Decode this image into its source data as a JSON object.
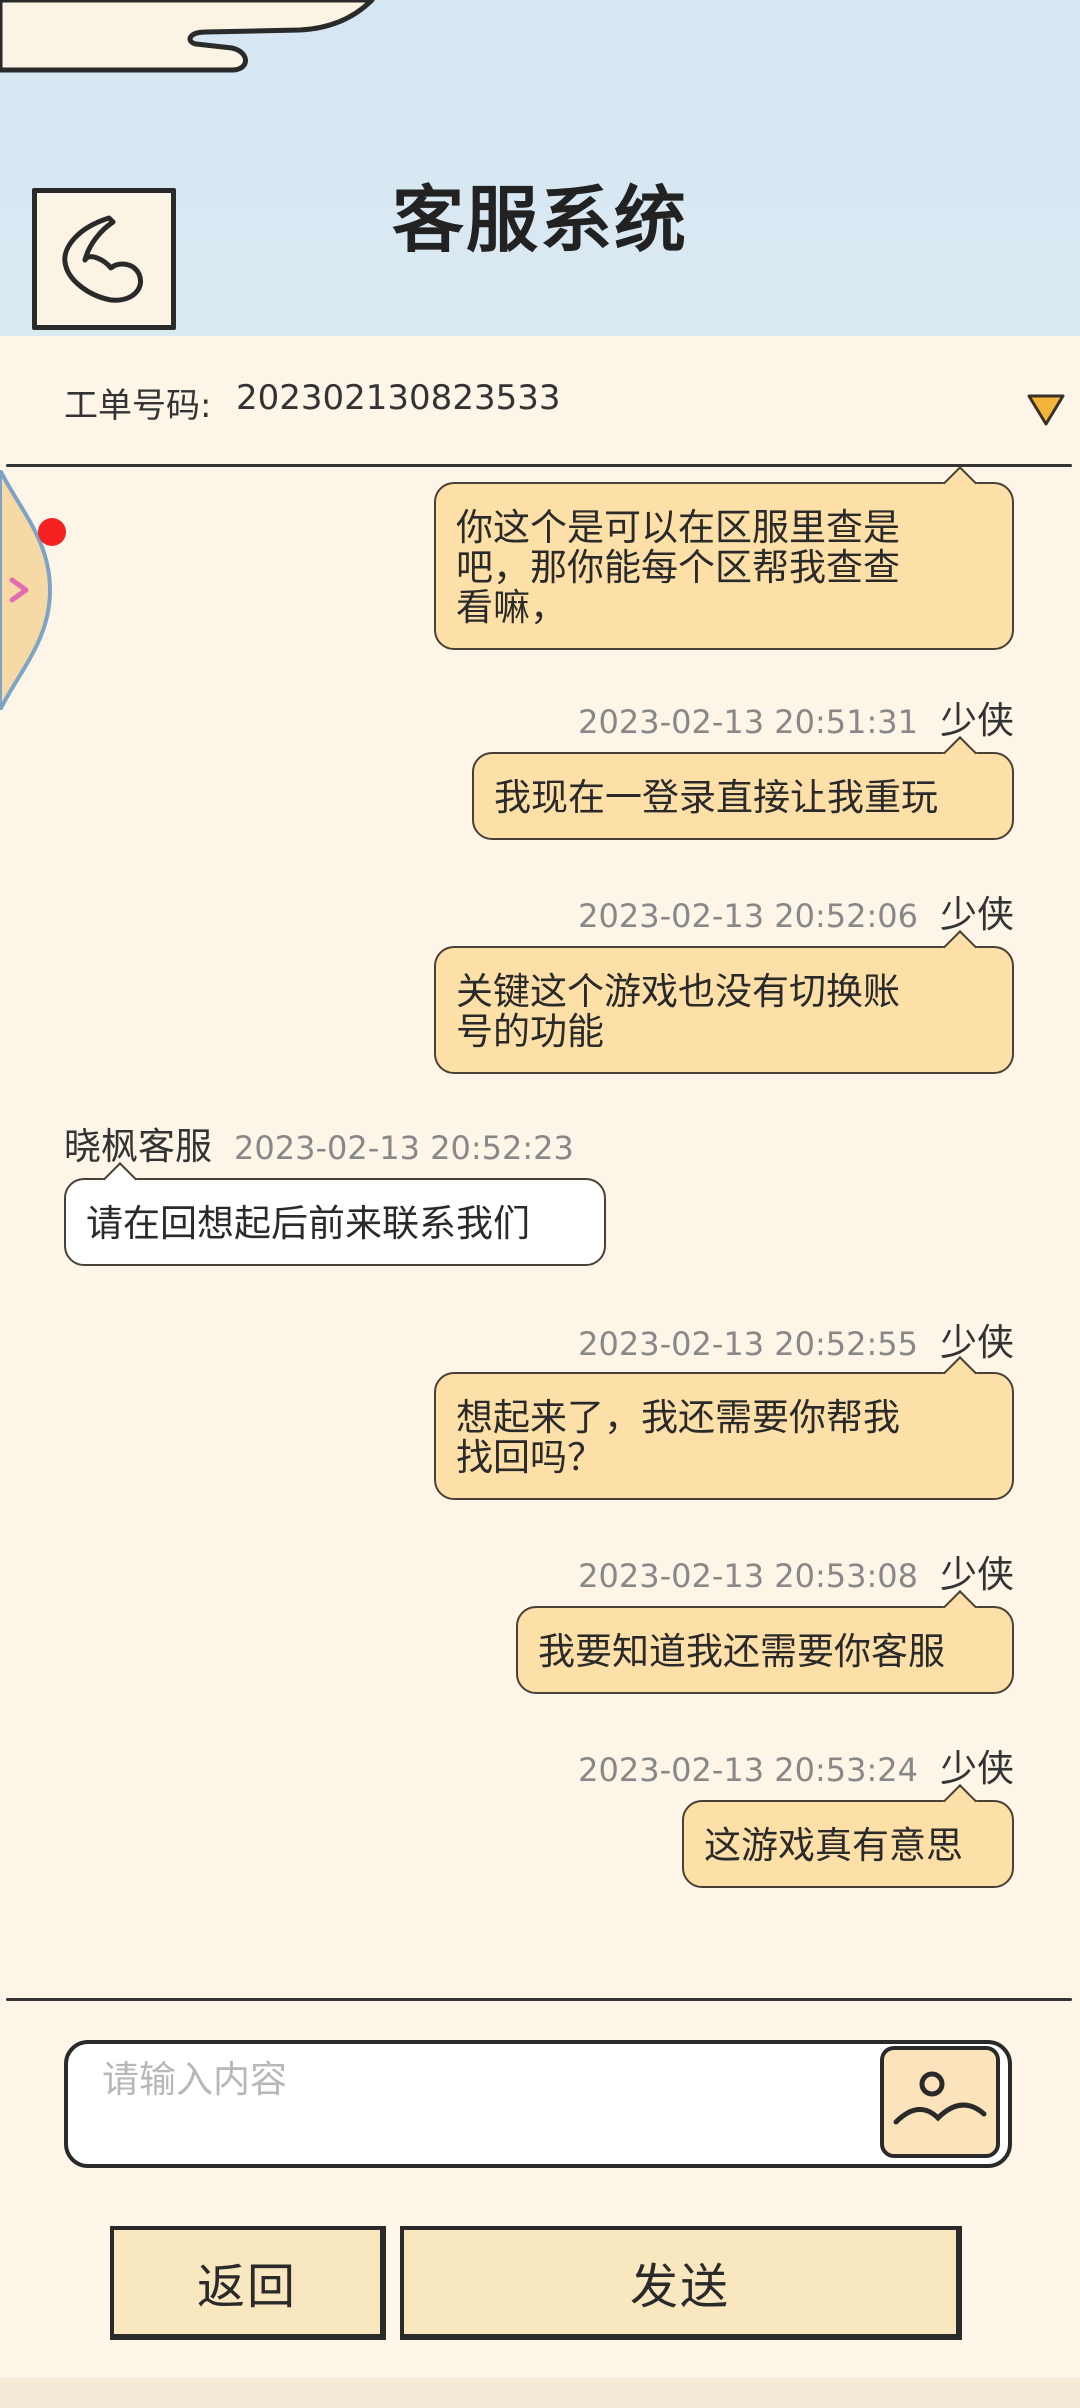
{
  "header": {
    "title": "客服系统",
    "back_icon": "back-heart-icon"
  },
  "ticket": {
    "label": "工单号码:",
    "number": "202302130823533",
    "dropdown_icon": "triangle-down-icon"
  },
  "messages": [
    {
      "from": "user",
      "sender": "",
      "time": "",
      "lines": [
        "你这个是可以在区服里查是",
        "吧，那你能每个区帮我查查",
        "看嘛，"
      ]
    },
    {
      "from": "user",
      "sender": "少侠",
      "time": "2023-02-13 20:51:31",
      "lines": [
        "我现在一登录直接让我重玩"
      ]
    },
    {
      "from": "user",
      "sender": "少侠",
      "time": "2023-02-13 20:52:06",
      "lines": [
        "关键这个游戏也没有切换账",
        "号的功能"
      ]
    },
    {
      "from": "agent",
      "sender": "晓枫客服",
      "time": "2023-02-13 20:52:23",
      "lines": [
        "请在回想起后前来联系我们"
      ]
    },
    {
      "from": "user",
      "sender": "少侠",
      "time": "2023-02-13 20:52:55",
      "lines": [
        "想起来了，我还需要你帮我",
        "找回吗？"
      ]
    },
    {
      "from": "user",
      "sender": "少侠",
      "time": "2023-02-13 20:53:08",
      "lines": [
        "我要知道我还需要你客服"
      ]
    },
    {
      "from": "user",
      "sender": "少侠",
      "time": "2023-02-13 20:53:24",
      "lines": [
        "这游戏真有意思"
      ]
    }
  ],
  "input": {
    "placeholder": "请输入内容",
    "value": "",
    "image_icon": "image-icon"
  },
  "buttons": {
    "back_label": "返回",
    "send_label": "发送"
  },
  "colors": {
    "header_bg": "#d5e7f3",
    "page_bg": "#fcf5e8",
    "user_bubble": "#fde0a8",
    "agent_bubble": "#ffffff",
    "button_bg": "#f9e7c0",
    "notify_dot": "#f42121"
  }
}
